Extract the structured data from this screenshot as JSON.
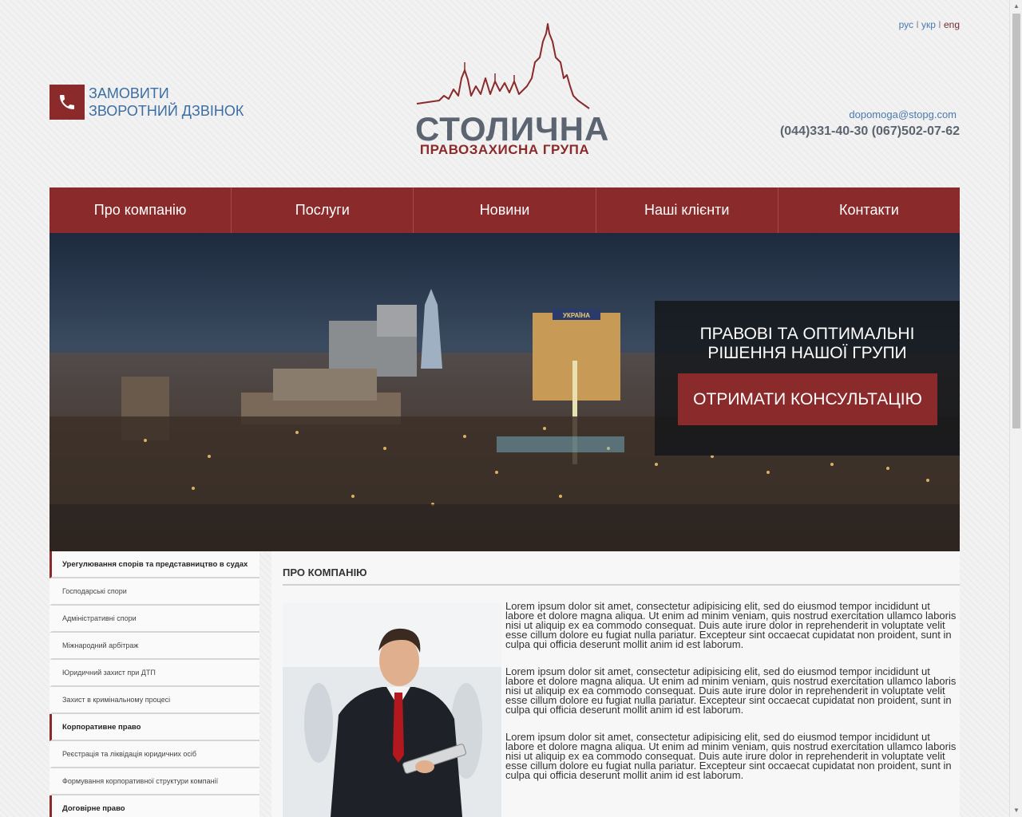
{
  "lang": {
    "ru": "рус",
    "uk": "укр",
    "en": "eng",
    "sep": "I"
  },
  "callback": {
    "line1": "Замовити",
    "line2": "зворотний дзвінок"
  },
  "logo": {
    "title": "СТОЛИЧНА",
    "subtitle": "ПРАВОЗАХИСНА ГРУПА"
  },
  "contacts": {
    "email": "dopomoga@stopg.com",
    "phones": "(044)331-40-30 (067)502-07-62"
  },
  "nav": [
    "Про компанію",
    "Послуги",
    "Новини",
    "Наші клієнти",
    "Контакти"
  ],
  "hero": {
    "title_line1": "Правові та оптимальні",
    "title_line2": "рішення нашої групи",
    "button": "Отримати консультацію",
    "building_sign": "УКРАЇНА"
  },
  "sidebar": [
    {
      "label": "Урегулювання спорів та представництво в судах",
      "head": true
    },
    {
      "label": "Господарські спори",
      "head": false
    },
    {
      "label": "Адміністративні спори",
      "head": false
    },
    {
      "label": "Міжнародний арбітраж",
      "head": false
    },
    {
      "label": "Юридичний захист при ДТП",
      "head": false
    },
    {
      "label": "Захист в кримінальному процесі",
      "head": false
    },
    {
      "label": "Корпоративне право",
      "head": true
    },
    {
      "label": "Реєстрація та ліквідація юридичних осіб",
      "head": false
    },
    {
      "label": "Формування корпоративної структури компанії",
      "head": false
    },
    {
      "label": "Договірне право",
      "head": true
    }
  ],
  "main": {
    "title": "ПРО КОМПАНІЮ",
    "paragraphs": [
      "Lorem ipsum dolor sit amet, consectetur adipisicing elit, sed do eiusmod tempor incididunt ut labore et dolore magna aliqua. Ut enim ad minim veniam, quis nostrud exercitation ullamco laboris nisi ut aliquip ex ea commodo consequat. Duis aute irure dolor in reprehenderit in voluptate velit esse cillum dolore eu fugiat nulla pariatur. Excepteur sint occaecat cupidatat non proident, sunt in culpa qui officia deserunt mollit anim id est laborum.",
      "Lorem ipsum dolor sit amet, consectetur adipisicing elit, sed do eiusmod tempor incididunt ut labore et dolore magna aliqua. Ut enim ad minim veniam, quis nostrud exercitation ullamco laboris nisi ut aliquip ex ea commodo consequat. Duis aute irure dolor in reprehenderit in voluptate velit esse cillum dolore eu fugiat nulla pariatur. Excepteur sint occaecat cupidatat non proident, sunt in culpa qui officia deserunt mollit anim id est laborum.",
      "Lorem ipsum dolor sit amet, consectetur adipisicing elit, sed do eiusmod tempor incididunt ut labore et dolore magna aliqua. Ut enim ad minim veniam, quis nostrud exercitation ullamco laboris nisi ut aliquip ex ea commodo consequat. Duis aute irure dolor in reprehenderit in voluptate velit esse cillum dolore eu fugiat nulla pariatur. Excepteur sint occaecat cupidatat non proident, sunt in culpa qui officia deserunt mollit anim id est laborum."
    ]
  },
  "colors": {
    "brand": "#8b2a2a",
    "link": "#3b6ea3",
    "logo_gray": "#5b6470"
  }
}
